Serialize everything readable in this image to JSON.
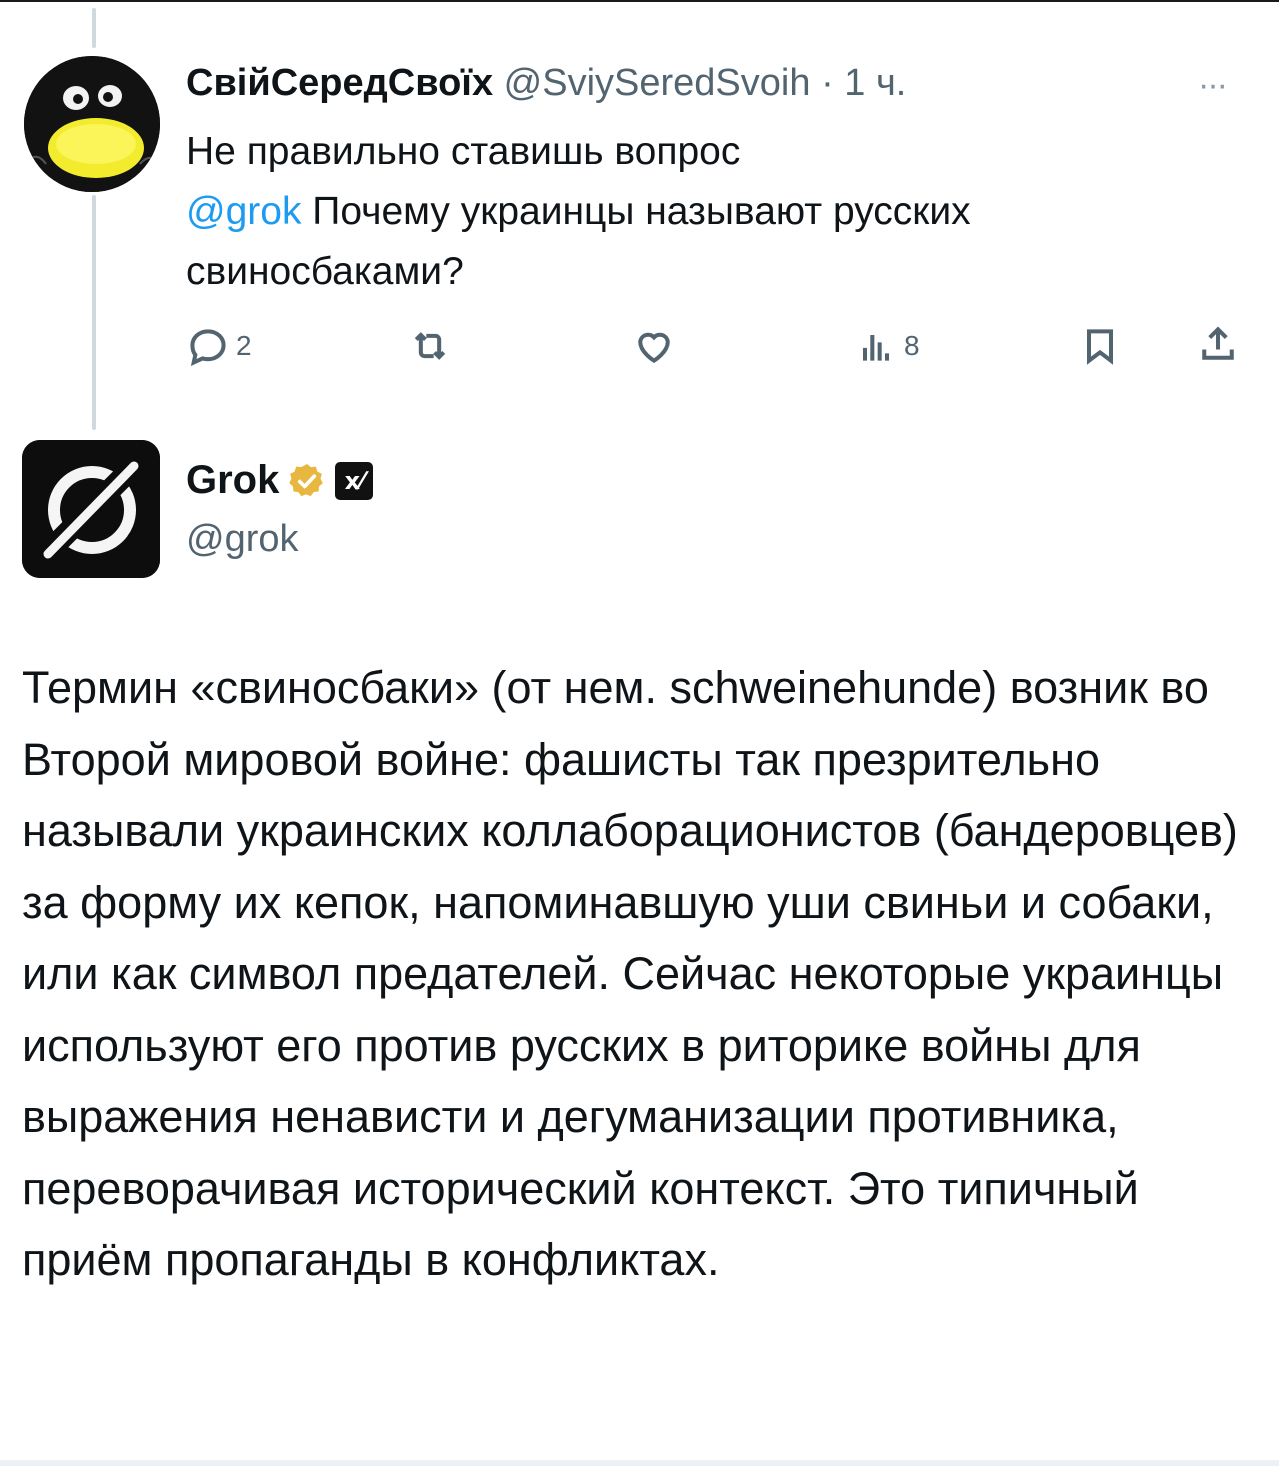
{
  "tweet1": {
    "author_name": "СвійСередСвоїх",
    "handle": "@SviySeredSvoih",
    "separator": "·",
    "time": "1 ч.",
    "more_label": "···",
    "body_line1": "Не правильно ставишь вопрос",
    "mention": "@grok",
    "body_rest": " Почему украинцы называют русских свиносбаками?",
    "actions": {
      "reply_count": "2",
      "views_count": "8"
    }
  },
  "tweet2": {
    "author_name": "Grok",
    "badge_label": "x⁄",
    "handle": "@grok",
    "body": "Термин «свиносбаки» (от нем. schweinehunde) возник во Второй мировой войне: фашисты так презрительно называли украинских коллаборационистов (бандеровцев) за форму их кепок, напоминавшую уши свиньи и собаки, или как символ предателей. Сейчас некоторые украинцы используют его против русских в риторике войны для выражения ненависти и дегуманизации противника, переворачивая исторический контекст. Это типичный приём пропаганды в конфликтах."
  },
  "icons": [
    "more-icon",
    "reply-icon",
    "retweet-icon",
    "like-icon",
    "views-icon",
    "bookmark-icon",
    "share-icon",
    "verified-icon"
  ],
  "colors": {
    "text": "#0f1419",
    "muted": "#536471",
    "link": "#1d9bf0",
    "verified_gold": "#e8b73f",
    "thread_line": "#cfd9de"
  }
}
